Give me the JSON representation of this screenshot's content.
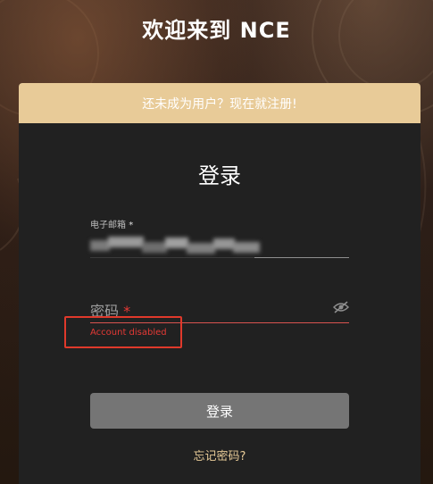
{
  "header": {
    "site_title": "欢迎来到 NCE"
  },
  "login_card": {
    "register_banner": "还未成为用户？现在就注册!",
    "heading": "登录",
    "email_field": {
      "label": "电子邮箱",
      "required_mark": "*"
    },
    "password_field": {
      "placeholder": "密码",
      "required_mark": "*",
      "toggle_icon": "eye-slash-icon",
      "error": "Account disabled"
    },
    "submit_label": "登录",
    "forgot_password_label": "忘记密码?"
  },
  "colors": {
    "banner": "#e8cb98",
    "card": "#212121",
    "error": "#e53935",
    "button": "#757575",
    "link": "#e8cb98"
  }
}
